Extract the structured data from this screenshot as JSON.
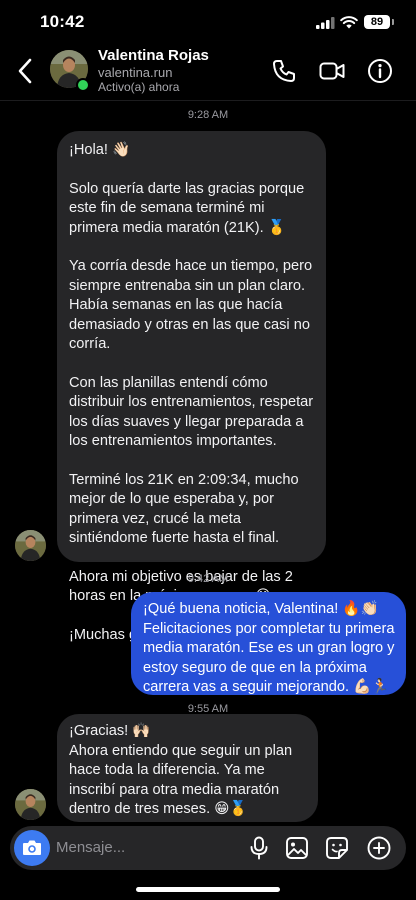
{
  "status": {
    "time": "10:42",
    "battery": "89"
  },
  "contact": {
    "name": "Valentina Rojas",
    "handle": "valentina.run",
    "status": "Activo(a) ahora"
  },
  "messages": {
    "ts1": "9:28 AM",
    "m1": [
      "¡Hola! 👋🏻",
      "Solo quería darte las gracias porque este fin de semana terminé mi primera media maratón (21K). 🥇",
      "Ya corría desde hace un tiempo, pero siempre entrenaba sin un plan claro. Había semanas en las que hacía demasiado y otras en las que casi no corría.",
      "Con las planillas entendí cómo distribuir los entrenamientos, respetar los días suaves y llegar preparada a los entrenamientos importantes.",
      "Terminé los 21K en 2:09:34, mucho mejor de lo que esperaba y, por primera vez, crucé la meta sintiéndome fuerte hasta el final.",
      "Ahora mi objetivo es bajar de las 2 horas en la próxima carrera. 😁",
      "¡Muchas gracias por todo! 🙌🏻"
    ],
    "ts2": "9:42 AM",
    "m2": "¡Qué buena noticia, Valentina! 🔥👏🏻 Felicitaciones por completar tu primera media maratón. Ese es un gran logro y estoy seguro de que en la próxima carrera vas a seguir mejorando. 💪🏻🏃🏻",
    "ts3": "9:55 AM",
    "m3": [
      "¡Gracias! 🙌🏻",
      "Ahora entiendo que seguir un plan hace toda la diferencia. Ya me inscribí para otra media maratón dentro de tres meses. 😁🥇"
    ]
  },
  "composer": {
    "placeholder": "Mensaje..."
  },
  "colors": {
    "outgoing": "#2750d8",
    "incoming": "#262628",
    "online": "#31d158",
    "camera": "#3d7bf2"
  }
}
